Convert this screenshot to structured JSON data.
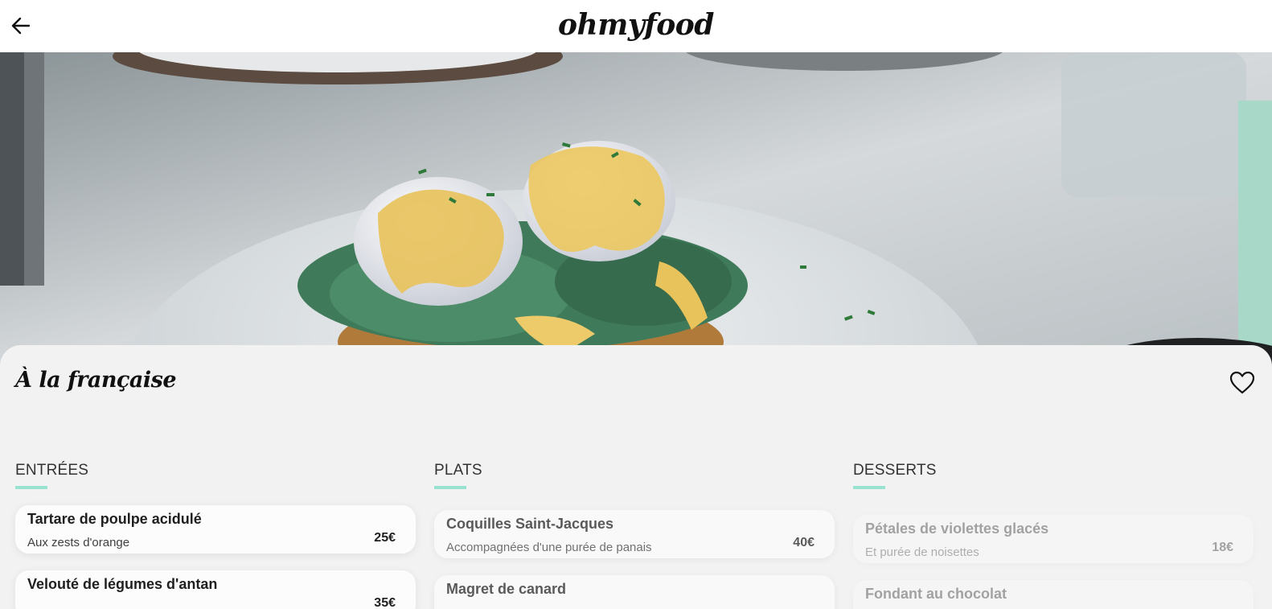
{
  "header": {
    "logo": "ohmyfood",
    "back_icon": "arrow-left-icon"
  },
  "hero": {
    "image": "eggs-benedict-photo"
  },
  "restaurant": {
    "name": "À la française",
    "favorite_icon": "heart-outline-icon"
  },
  "menu": {
    "accent_color": "#99e2d0",
    "sections": [
      {
        "title": "ENTRÉES",
        "items": [
          {
            "name": "Tartare de poulpe acidulé",
            "description": "Aux zests d'orange",
            "price": "25€"
          },
          {
            "name": "Velouté de légumes d'antan",
            "description": "",
            "price": "35€"
          }
        ]
      },
      {
        "title": "PLATS",
        "items": [
          {
            "name": "Coquilles Saint-Jacques",
            "description": "Accompagnées d'une purée de panais",
            "price": "40€"
          },
          {
            "name": "Magret de canard",
            "description": "",
            "price": ""
          }
        ]
      },
      {
        "title": "DESSERTS",
        "items": [
          {
            "name": "Pétales de violettes glacés",
            "description": "Et purée de noisettes",
            "price": "18€"
          },
          {
            "name": "Fondant au chocolat",
            "description": "",
            "price": ""
          }
        ]
      }
    ]
  }
}
